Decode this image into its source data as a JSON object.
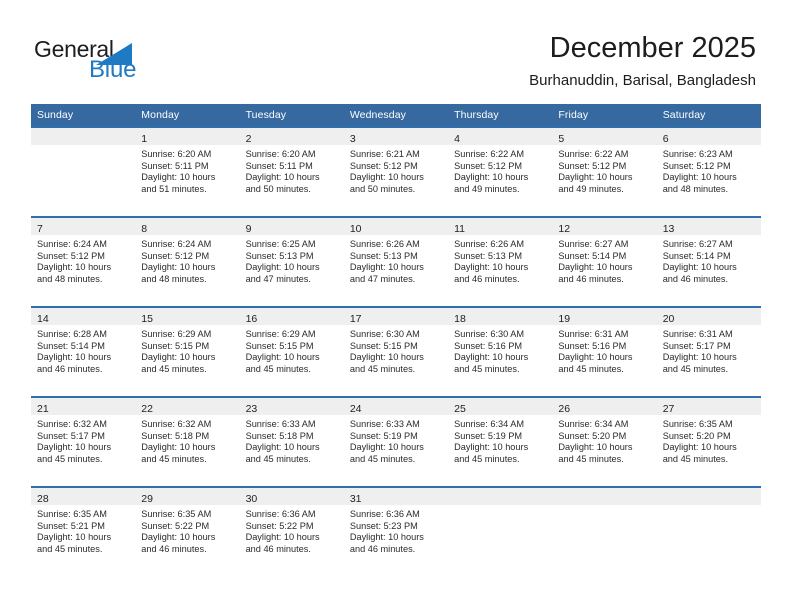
{
  "brand": {
    "name_part1": "General",
    "name_part2": "Blue",
    "flag_icon": "triangle-flag-icon",
    "accent_color": "#1f7ac4"
  },
  "header": {
    "title": "December 2025",
    "subtitle": "Burhanuddin, Barisal, Bangladesh"
  },
  "calendar": {
    "header_bg": "#36699f",
    "row_border_color": "#2f6fad",
    "daynum_band_bg": "#efefef",
    "weekday_headers": [
      "Sunday",
      "Monday",
      "Tuesday",
      "Wednesday",
      "Thursday",
      "Friday",
      "Saturday"
    ],
    "weeks": [
      [
        {
          "day": "",
          "sunrise": "",
          "sunset": "",
          "daylight1": "",
          "daylight2": ""
        },
        {
          "day": "1",
          "sunrise": "Sunrise: 6:20 AM",
          "sunset": "Sunset: 5:11 PM",
          "daylight1": "Daylight: 10 hours",
          "daylight2": "and 51 minutes."
        },
        {
          "day": "2",
          "sunrise": "Sunrise: 6:20 AM",
          "sunset": "Sunset: 5:11 PM",
          "daylight1": "Daylight: 10 hours",
          "daylight2": "and 50 minutes."
        },
        {
          "day": "3",
          "sunrise": "Sunrise: 6:21 AM",
          "sunset": "Sunset: 5:12 PM",
          "daylight1": "Daylight: 10 hours",
          "daylight2": "and 50 minutes."
        },
        {
          "day": "4",
          "sunrise": "Sunrise: 6:22 AM",
          "sunset": "Sunset: 5:12 PM",
          "daylight1": "Daylight: 10 hours",
          "daylight2": "and 49 minutes."
        },
        {
          "day": "5",
          "sunrise": "Sunrise: 6:22 AM",
          "sunset": "Sunset: 5:12 PM",
          "daylight1": "Daylight: 10 hours",
          "daylight2": "and 49 minutes."
        },
        {
          "day": "6",
          "sunrise": "Sunrise: 6:23 AM",
          "sunset": "Sunset: 5:12 PM",
          "daylight1": "Daylight: 10 hours",
          "daylight2": "and 48 minutes."
        }
      ],
      [
        {
          "day": "7",
          "sunrise": "Sunrise: 6:24 AM",
          "sunset": "Sunset: 5:12 PM",
          "daylight1": "Daylight: 10 hours",
          "daylight2": "and 48 minutes."
        },
        {
          "day": "8",
          "sunrise": "Sunrise: 6:24 AM",
          "sunset": "Sunset: 5:12 PM",
          "daylight1": "Daylight: 10 hours",
          "daylight2": "and 48 minutes."
        },
        {
          "day": "9",
          "sunrise": "Sunrise: 6:25 AM",
          "sunset": "Sunset: 5:13 PM",
          "daylight1": "Daylight: 10 hours",
          "daylight2": "and 47 minutes."
        },
        {
          "day": "10",
          "sunrise": "Sunrise: 6:26 AM",
          "sunset": "Sunset: 5:13 PM",
          "daylight1": "Daylight: 10 hours",
          "daylight2": "and 47 minutes."
        },
        {
          "day": "11",
          "sunrise": "Sunrise: 6:26 AM",
          "sunset": "Sunset: 5:13 PM",
          "daylight1": "Daylight: 10 hours",
          "daylight2": "and 46 minutes."
        },
        {
          "day": "12",
          "sunrise": "Sunrise: 6:27 AM",
          "sunset": "Sunset: 5:14 PM",
          "daylight1": "Daylight: 10 hours",
          "daylight2": "and 46 minutes."
        },
        {
          "day": "13",
          "sunrise": "Sunrise: 6:27 AM",
          "sunset": "Sunset: 5:14 PM",
          "daylight1": "Daylight: 10 hours",
          "daylight2": "and 46 minutes."
        }
      ],
      [
        {
          "day": "14",
          "sunrise": "Sunrise: 6:28 AM",
          "sunset": "Sunset: 5:14 PM",
          "daylight1": "Daylight: 10 hours",
          "daylight2": "and 46 minutes."
        },
        {
          "day": "15",
          "sunrise": "Sunrise: 6:29 AM",
          "sunset": "Sunset: 5:15 PM",
          "daylight1": "Daylight: 10 hours",
          "daylight2": "and 45 minutes."
        },
        {
          "day": "16",
          "sunrise": "Sunrise: 6:29 AM",
          "sunset": "Sunset: 5:15 PM",
          "daylight1": "Daylight: 10 hours",
          "daylight2": "and 45 minutes."
        },
        {
          "day": "17",
          "sunrise": "Sunrise: 6:30 AM",
          "sunset": "Sunset: 5:15 PM",
          "daylight1": "Daylight: 10 hours",
          "daylight2": "and 45 minutes."
        },
        {
          "day": "18",
          "sunrise": "Sunrise: 6:30 AM",
          "sunset": "Sunset: 5:16 PM",
          "daylight1": "Daylight: 10 hours",
          "daylight2": "and 45 minutes."
        },
        {
          "day": "19",
          "sunrise": "Sunrise: 6:31 AM",
          "sunset": "Sunset: 5:16 PM",
          "daylight1": "Daylight: 10 hours",
          "daylight2": "and 45 minutes."
        },
        {
          "day": "20",
          "sunrise": "Sunrise: 6:31 AM",
          "sunset": "Sunset: 5:17 PM",
          "daylight1": "Daylight: 10 hours",
          "daylight2": "and 45 minutes."
        }
      ],
      [
        {
          "day": "21",
          "sunrise": "Sunrise: 6:32 AM",
          "sunset": "Sunset: 5:17 PM",
          "daylight1": "Daylight: 10 hours",
          "daylight2": "and 45 minutes."
        },
        {
          "day": "22",
          "sunrise": "Sunrise: 6:32 AM",
          "sunset": "Sunset: 5:18 PM",
          "daylight1": "Daylight: 10 hours",
          "daylight2": "and 45 minutes."
        },
        {
          "day": "23",
          "sunrise": "Sunrise: 6:33 AM",
          "sunset": "Sunset: 5:18 PM",
          "daylight1": "Daylight: 10 hours",
          "daylight2": "and 45 minutes."
        },
        {
          "day": "24",
          "sunrise": "Sunrise: 6:33 AM",
          "sunset": "Sunset: 5:19 PM",
          "daylight1": "Daylight: 10 hours",
          "daylight2": "and 45 minutes."
        },
        {
          "day": "25",
          "sunrise": "Sunrise: 6:34 AM",
          "sunset": "Sunset: 5:19 PM",
          "daylight1": "Daylight: 10 hours",
          "daylight2": "and 45 minutes."
        },
        {
          "day": "26",
          "sunrise": "Sunrise: 6:34 AM",
          "sunset": "Sunset: 5:20 PM",
          "daylight1": "Daylight: 10 hours",
          "daylight2": "and 45 minutes."
        },
        {
          "day": "27",
          "sunrise": "Sunrise: 6:35 AM",
          "sunset": "Sunset: 5:20 PM",
          "daylight1": "Daylight: 10 hours",
          "daylight2": "and 45 minutes."
        }
      ],
      [
        {
          "day": "28",
          "sunrise": "Sunrise: 6:35 AM",
          "sunset": "Sunset: 5:21 PM",
          "daylight1": "Daylight: 10 hours",
          "daylight2": "and 45 minutes."
        },
        {
          "day": "29",
          "sunrise": "Sunrise: 6:35 AM",
          "sunset": "Sunset: 5:22 PM",
          "daylight1": "Daylight: 10 hours",
          "daylight2": "and 46 minutes."
        },
        {
          "day": "30",
          "sunrise": "Sunrise: 6:36 AM",
          "sunset": "Sunset: 5:22 PM",
          "daylight1": "Daylight: 10 hours",
          "daylight2": "and 46 minutes."
        },
        {
          "day": "31",
          "sunrise": "Sunrise: 6:36 AM",
          "sunset": "Sunset: 5:23 PM",
          "daylight1": "Daylight: 10 hours",
          "daylight2": "and 46 minutes."
        },
        {
          "day": "",
          "sunrise": "",
          "sunset": "",
          "daylight1": "",
          "daylight2": ""
        },
        {
          "day": "",
          "sunrise": "",
          "sunset": "",
          "daylight1": "",
          "daylight2": ""
        },
        {
          "day": "",
          "sunrise": "",
          "sunset": "",
          "daylight1": "",
          "daylight2": ""
        }
      ]
    ]
  }
}
